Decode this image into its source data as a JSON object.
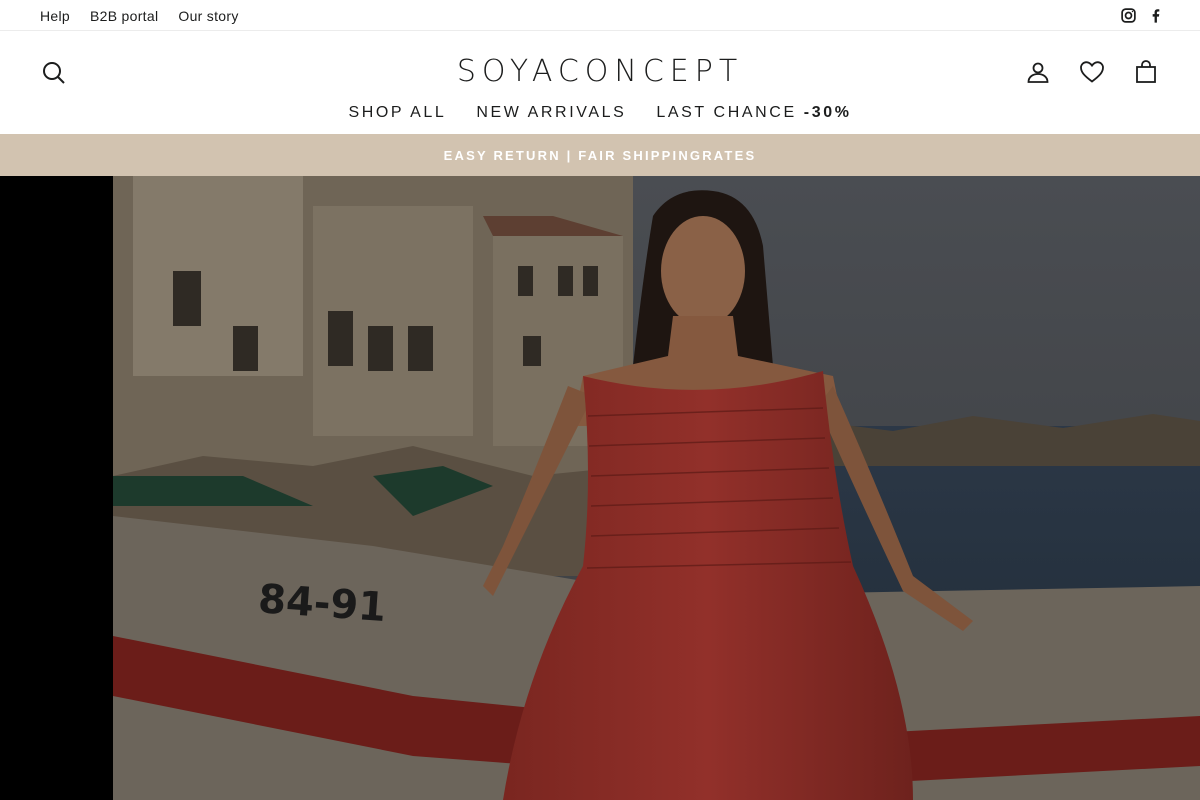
{
  "utility": {
    "links": [
      "Help",
      "B2B portal",
      "Our story"
    ],
    "social_icons": [
      "instagram-icon",
      "facebook-icon"
    ]
  },
  "header": {
    "logo": "SOYACONCEPT",
    "search_icon": "search-icon",
    "account_icon": "user-icon",
    "wishlist_icon": "heart-icon",
    "cart_icon": "bag-icon"
  },
  "nav": {
    "shop_all": "SHOP ALL",
    "new_arrivals": "NEW ARRIVALS",
    "last_chance": "LAST CHANCE ",
    "last_chance_discount": "-30%"
  },
  "announcement": {
    "text": "EASY RETURN | FAIR SHIPPINGRATES",
    "background": "#d2c3b0"
  },
  "hero": {
    "boat_number": "84-91",
    "overlay": "dimmed"
  }
}
